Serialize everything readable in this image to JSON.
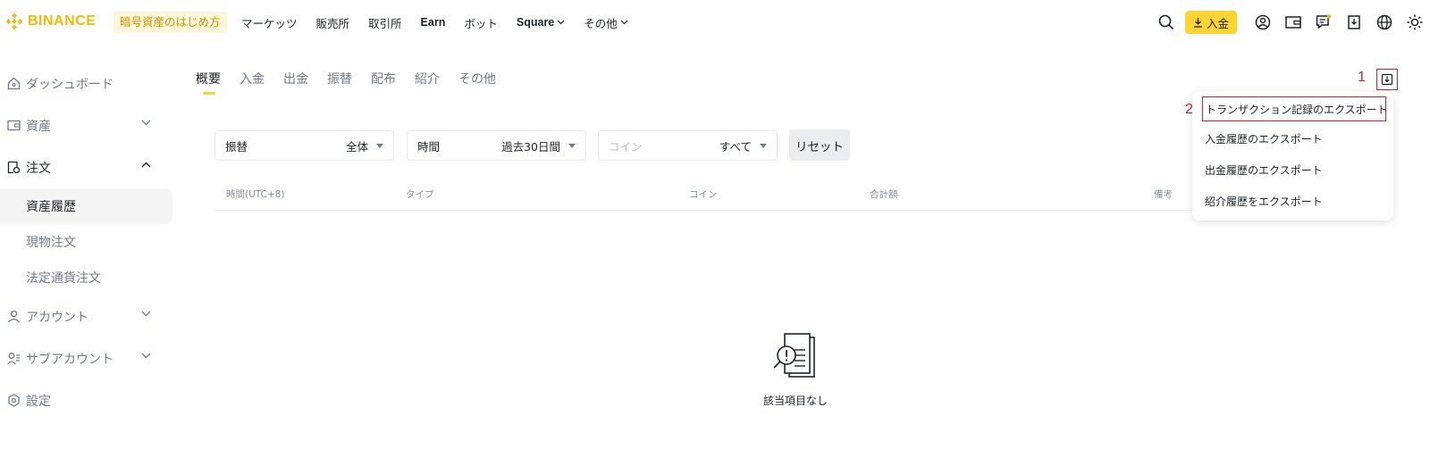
{
  "brand": {
    "name": "BINANCE",
    "color": "#f0b90b"
  },
  "nav": {
    "beginner_label": "暗号資産のはじめ方",
    "items": [
      {
        "label": "マーケッツ"
      },
      {
        "label": "販売所"
      },
      {
        "label": "取引所"
      },
      {
        "label": "Earn"
      },
      {
        "label": "ボット"
      },
      {
        "label": "Square"
      },
      {
        "label": "その他"
      }
    ],
    "deposit_label": "入金",
    "icons": [
      "search-icon",
      "download-icon",
      "user-icon",
      "wallet-icon",
      "message-icon",
      "download-app-icon",
      "globe-icon",
      "theme-icon"
    ]
  },
  "sidebar": {
    "items": [
      {
        "label": "ダッシュボード",
        "icon": "home-icon"
      },
      {
        "label": "資産",
        "icon": "wallet-icon"
      },
      {
        "label": "注文",
        "icon": "order-icon"
      },
      {
        "label": "アカウント",
        "icon": "user-icon"
      },
      {
        "label": "サブアカウント",
        "icon": "sub-account-icon"
      },
      {
        "label": "設定",
        "icon": "settings-icon"
      }
    ],
    "order_sub": [
      {
        "label": "資産履歴"
      },
      {
        "label": "現物注文"
      },
      {
        "label": "法定通貨注文"
      }
    ]
  },
  "tabs": [
    {
      "label": "概要"
    },
    {
      "label": "入金"
    },
    {
      "label": "出金"
    },
    {
      "label": "振替"
    },
    {
      "label": "配布"
    },
    {
      "label": "紹介"
    },
    {
      "label": "その他"
    }
  ],
  "filters": {
    "type": {
      "label": "振替",
      "value": "全体"
    },
    "time": {
      "label": "時間",
      "value": "過去30日間"
    },
    "coin": {
      "placeholder": "コイン",
      "value": "すべて"
    },
    "reset_label": "リセット"
  },
  "table": {
    "columns": [
      "時間(UTC+8)",
      "タイプ",
      "コイン",
      "合計額",
      "備考"
    ]
  },
  "empty_text": "該当項目なし",
  "export": {
    "annotation_1": "1",
    "annotation_2": "2",
    "menu": [
      {
        "label": "トランザクション記録のエクスポート"
      },
      {
        "label": "入金履歴のエクスポート"
      },
      {
        "label": "出金履歴のエクスポート"
      },
      {
        "label": "紹介履歴をエクスポート"
      }
    ]
  },
  "colors": {
    "accent": "#fcd535",
    "annotation": "#e02020",
    "text": "#1e2329",
    "muted": "#707a8a"
  }
}
